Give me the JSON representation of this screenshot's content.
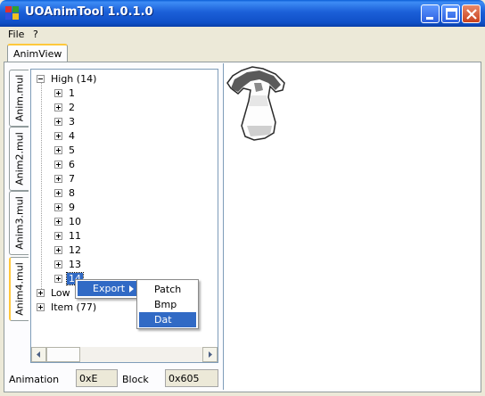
{
  "window": {
    "title": "UOAnimTool 1.0.1.0"
  },
  "menu": {
    "items": [
      "File",
      "?"
    ]
  },
  "tabs": {
    "main": "AnimView"
  },
  "side_tabs": [
    "Anim.mul",
    "Anim2.mul",
    "Anim3.mul",
    "Anim4.mul"
  ],
  "tree": {
    "root_high": "High (14)",
    "children": [
      "1",
      "2",
      "3",
      "4",
      "5",
      "6",
      "7",
      "8",
      "9",
      "10",
      "11",
      "12",
      "13",
      "14"
    ],
    "root_low": "Low",
    "root_item": "Item (77)"
  },
  "status": {
    "animation_label": "Animation",
    "animation_value": "0xE",
    "block_label": "Block",
    "block_value": "0x605"
  },
  "context_menu": {
    "export_label": "Export",
    "submenu": [
      "Patch",
      "Bmp",
      "Dat"
    ]
  },
  "icons": {
    "app": "app-icon",
    "minimize": "minimize-icon",
    "maximize": "maximize-icon",
    "close": "close-icon",
    "submenu_arrow": "chevron-right-icon"
  },
  "colors": {
    "titlebar": "#0f4fc7",
    "selection": "#316ac5",
    "window_bg": "#ece9d8"
  }
}
